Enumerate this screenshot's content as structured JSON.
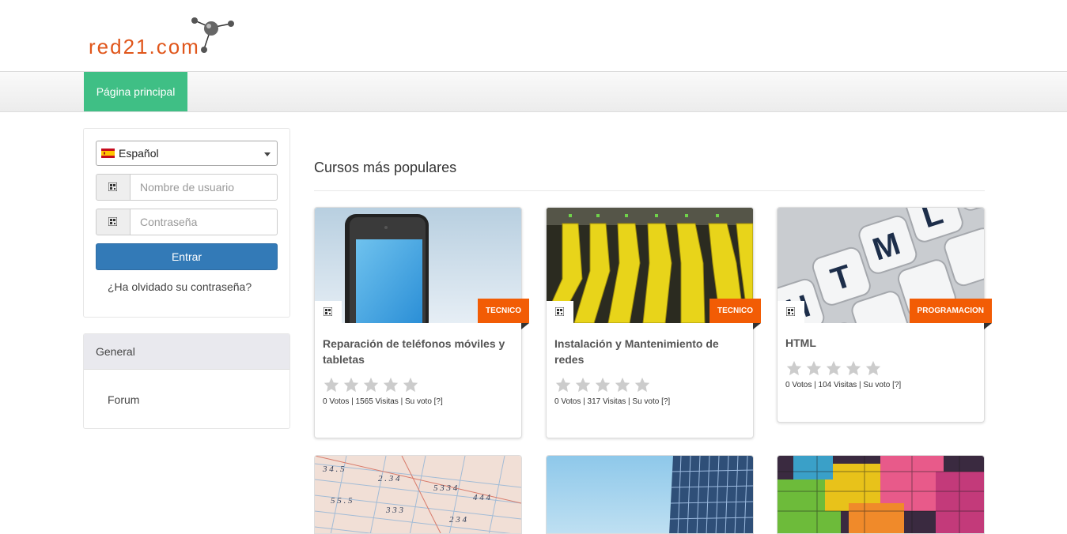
{
  "header": {
    "logo_text": "red21.com"
  },
  "nav": {
    "items": [
      {
        "label": "Página principal"
      }
    ]
  },
  "login": {
    "language": "Español",
    "username_placeholder": "Nombre de usuario",
    "password_placeholder": "Contraseña",
    "login_label": "Entrar",
    "forgot_label": "¿Ha olvidado su contraseña?"
  },
  "general": {
    "title": "General",
    "forum_label": "Forum"
  },
  "main": {
    "title": "Cursos más populares",
    "courses": [
      {
        "title": "Reparación de teléfonos móviles y tabletas",
        "category": "TECNICO",
        "stats": "0 Votos | 1565 Visitas | Su voto [?]",
        "rating": 0
      },
      {
        "title": "Instalación y Mantenimiento de redes",
        "category": "TECNICO",
        "stats": "0 Votos | 317 Visitas | Su voto [?]",
        "rating": 0
      },
      {
        "title": "HTML",
        "category": "PROGRAMACION",
        "stats": "0 Votos | 104 Visitas | Su voto [?]",
        "rating": 0
      }
    ]
  },
  "colors": {
    "accent_green": "#3fbf85",
    "primary_blue": "#337ab7",
    "ribbon_orange": "#f25c05",
    "logo_orange": "#e0561b"
  }
}
